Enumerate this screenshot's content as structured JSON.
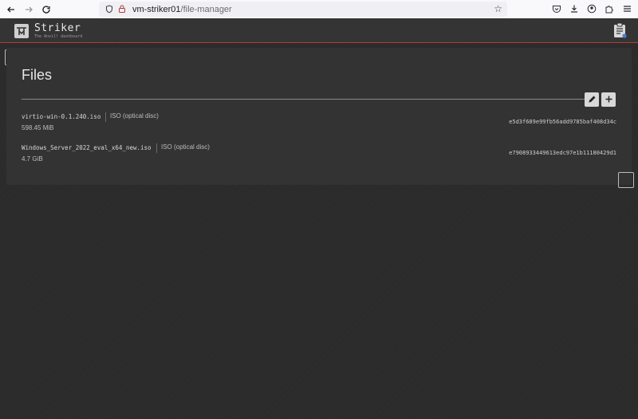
{
  "browser": {
    "url_host": "vm-striker01",
    "url_path": "/file-manager"
  },
  "app": {
    "logo_title": "Striker",
    "logo_subtitle": "The Anvil! dashboard"
  },
  "files_panel": {
    "title": "Files",
    "files": [
      {
        "name": "virtio-win-0.1.240.iso",
        "type": "ISO (optical disc)",
        "size": "598.45 MiB",
        "hash": "e5d3f689e99fb56add9785baf408d34c"
      },
      {
        "name": "Windows_Server_2022_eval_x64_new.iso",
        "type": "ISO (optical disc)",
        "size": "4.7 GiB",
        "hash": "e7908933449613edc97e1b11180429d1"
      }
    ]
  },
  "icons": {
    "back": "arrow-left-icon",
    "forward": "arrow-right-icon",
    "reload": "reload-icon",
    "shield": "shield-icon",
    "lock": "lock-icon",
    "star": "star-icon",
    "pocket": "pocket-icon",
    "download": "download-icon",
    "account": "account-icon",
    "extensions": "extensions-icon",
    "menu": "hamburger-menu-icon",
    "edit": "pencil-icon",
    "add": "plus-icon",
    "clipboard": "clipboard-icon"
  },
  "colors": {
    "header_accent": "#b33a3a",
    "panel_bg": "#333333",
    "page_bg": "#2a2a2a"
  }
}
